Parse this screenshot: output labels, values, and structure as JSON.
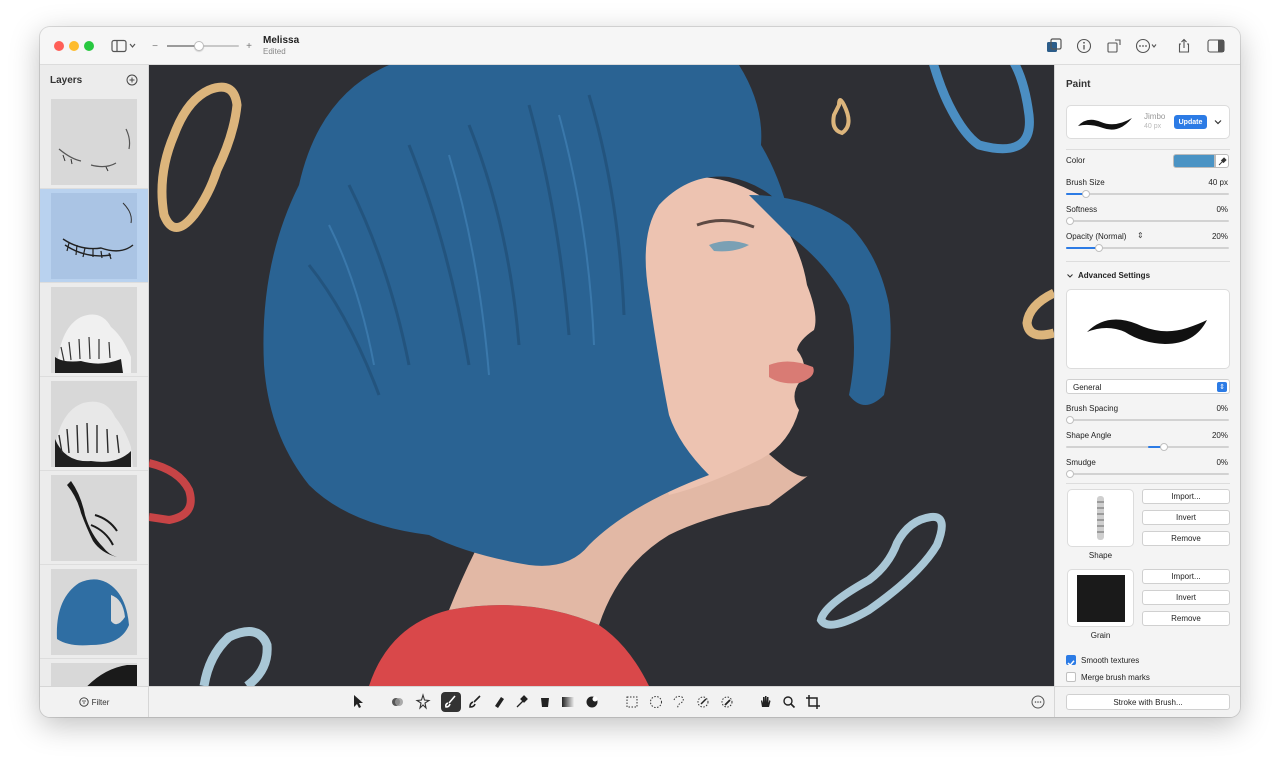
{
  "window": {
    "title": "Melissa",
    "subtitle": "Edited",
    "zoom_minus": "−",
    "zoom_plus": "+",
    "zoom_level": 0.45
  },
  "layers": {
    "title": "Layers",
    "filter_label": "Filter",
    "selected_index": 1,
    "count_visible": 7
  },
  "toolbar": {
    "tools": [
      "select-icon",
      "blend-icon",
      "magic-icon",
      "paintbrush-icon",
      "brush-icon",
      "eraser-icon",
      "eyedropper-icon",
      "fill-icon",
      "gradient-icon",
      "clone-icon",
      "rect-select-icon",
      "ellipse-select-icon",
      "lasso-icon",
      "magic-wand-icon",
      "quick-select-icon",
      "hand-icon",
      "zoom-icon",
      "crop-icon"
    ],
    "active_tool": "paintbrush-icon"
  },
  "panel": {
    "title": "Paint",
    "brush_name": "Jimbo",
    "brush_size_hint": "40 px",
    "update_label": "Update",
    "color_label": "Color",
    "color_value": "#4a93c4",
    "brush_size_label": "Brush Size",
    "brush_size_value": "40 px",
    "brush_size_level": 0.12,
    "softness_label": "Softness",
    "softness_value": "0%",
    "softness_level": 0.0,
    "opacity_label": "Opacity (Normal)",
    "opacity_value": "20%",
    "opacity_level": 0.2,
    "advanced_label": "Advanced Settings",
    "category_value": "General",
    "spacing_label": "Brush Spacing",
    "spacing_value": "0%",
    "spacing_level": 0.0,
    "angle_label": "Shape Angle",
    "angle_value": "20%",
    "angle_level": 0.6,
    "smudge_label": "Smudge",
    "smudge_value": "0%",
    "smudge_level": 0.0,
    "shape_label": "Shape",
    "grain_label": "Grain",
    "import_label": "Import...",
    "invert_label": "Invert",
    "remove_label": "Remove",
    "smooth_label": "Smooth textures",
    "smooth_checked": true,
    "merge_label": "Merge brush marks",
    "merge_checked": false,
    "stroke_button": "Stroke with Brush..."
  },
  "colors": {
    "accent": "#2c7be5",
    "hair": "#2a6393",
    "canvas_bg": "#2e2f34"
  }
}
